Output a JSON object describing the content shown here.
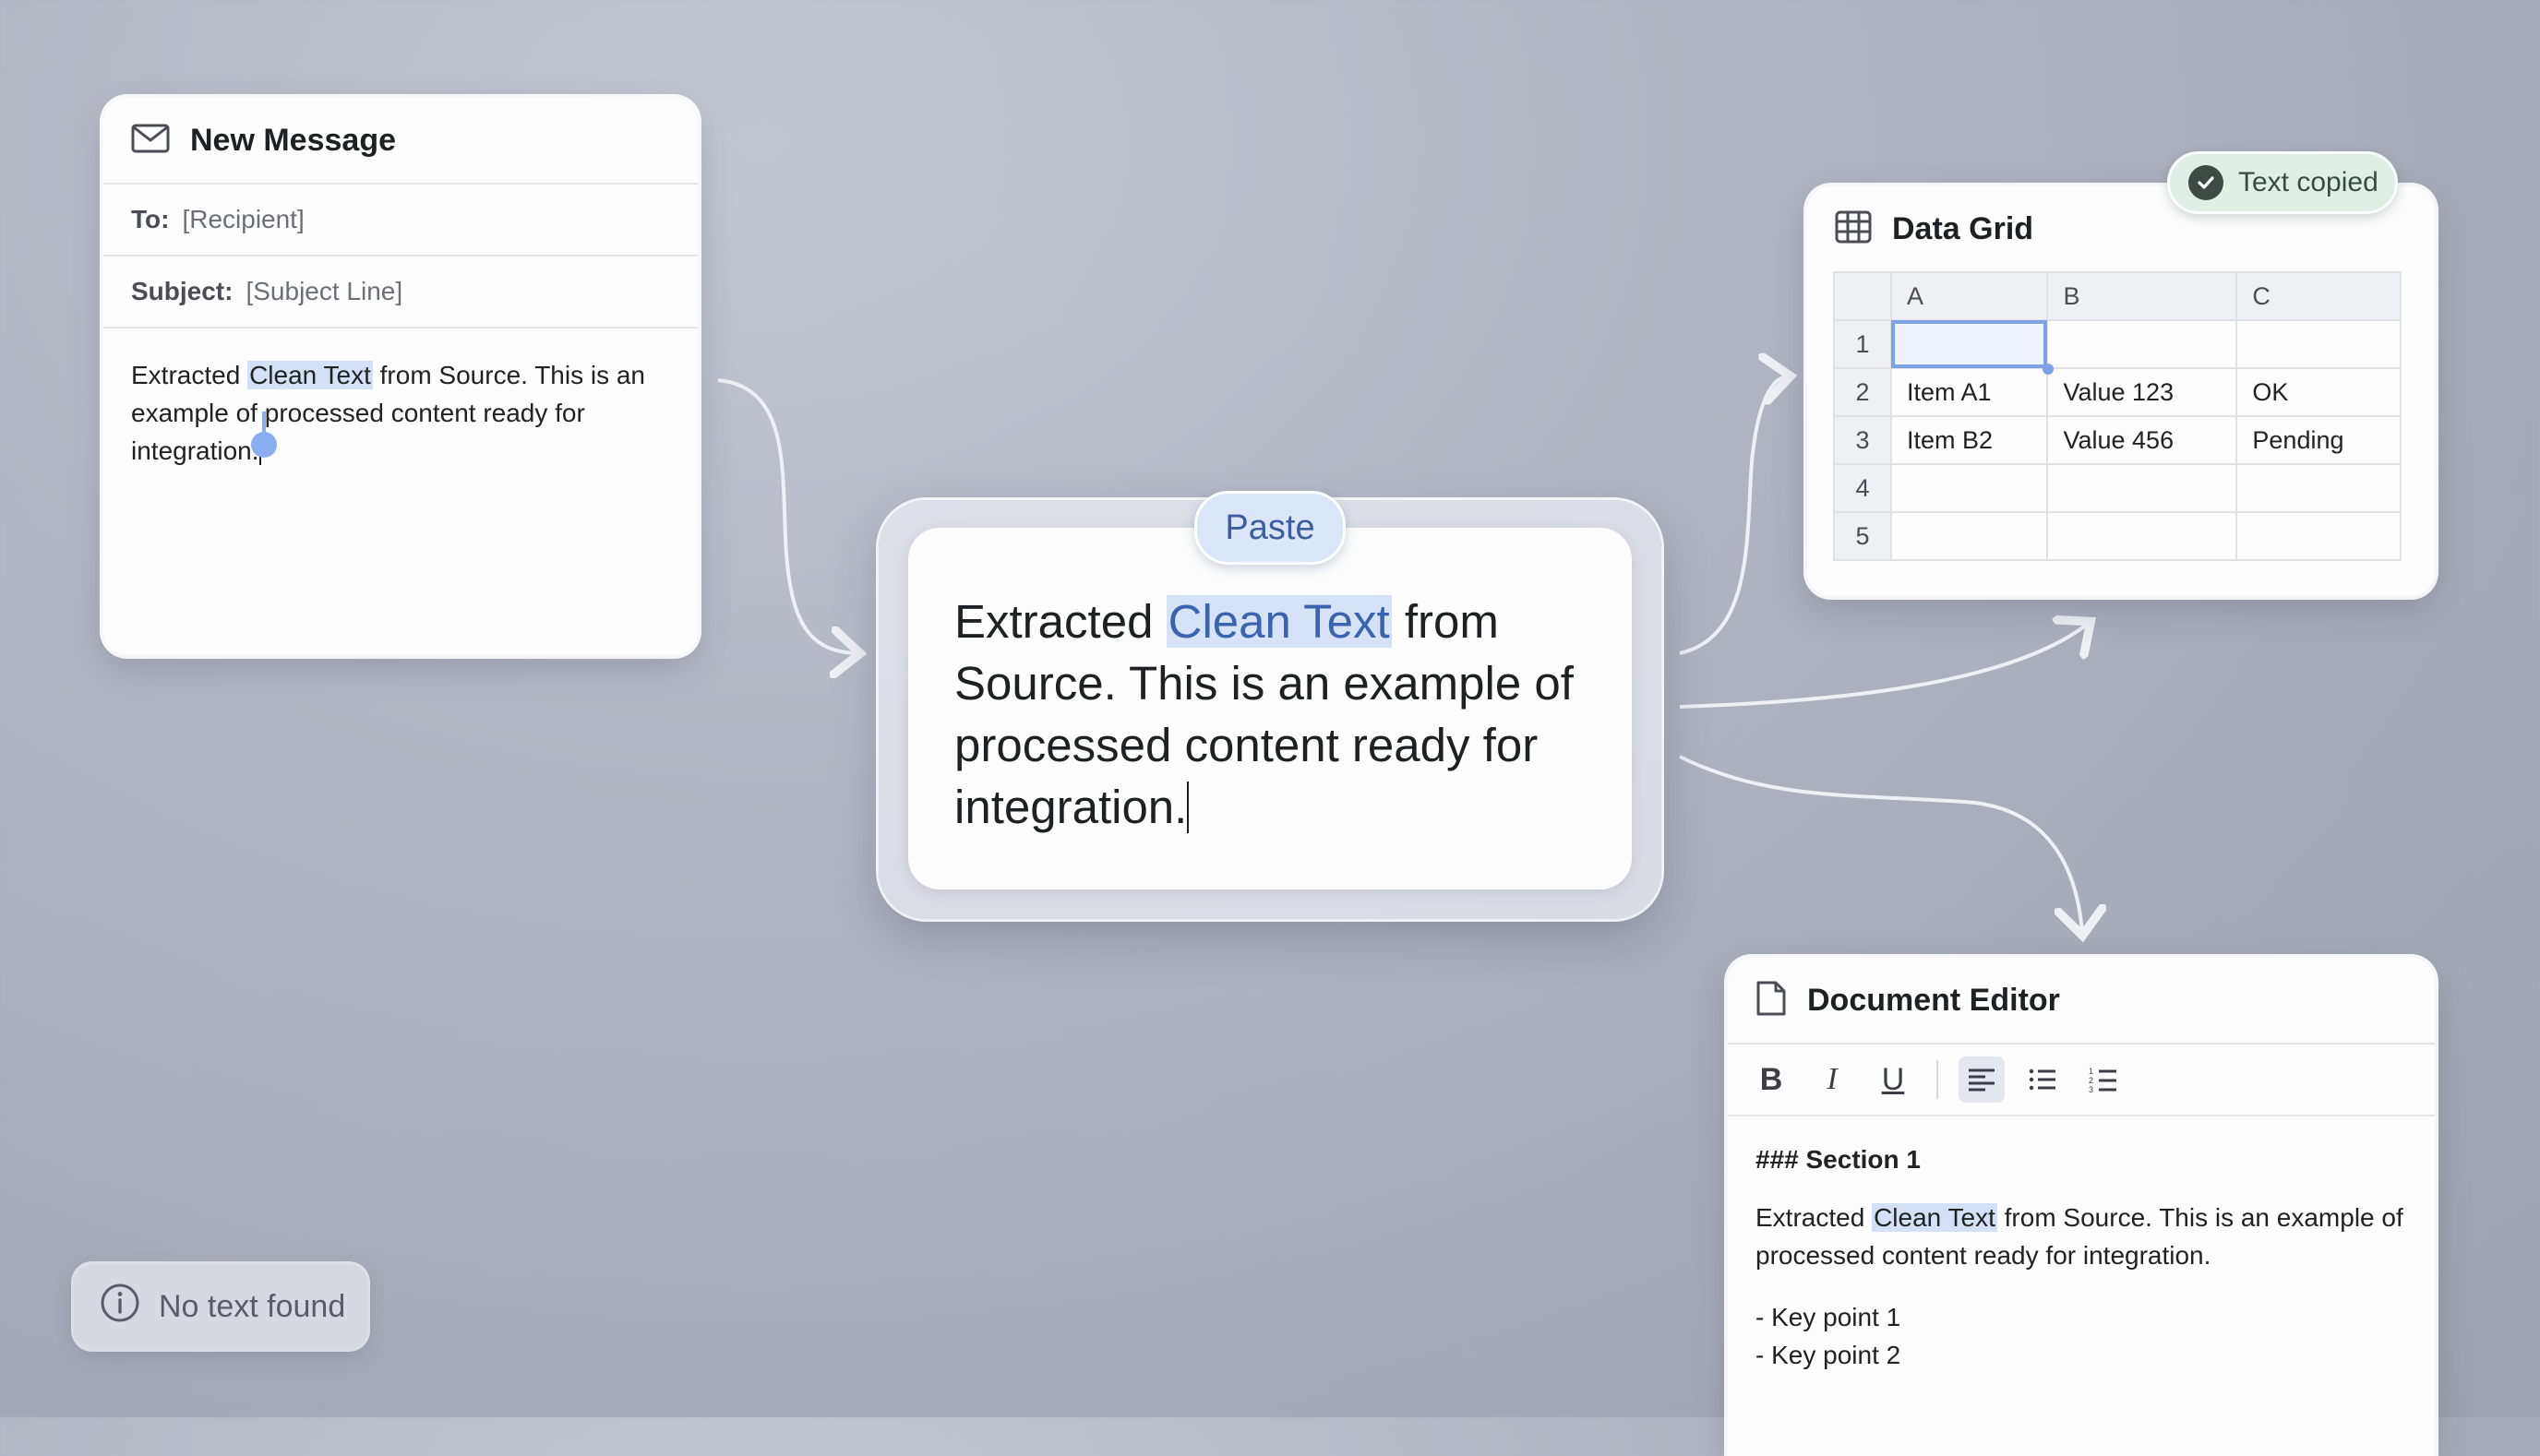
{
  "email": {
    "title": "New Message",
    "to_label": "To:",
    "to_value": "[Recipient]",
    "subject_label": "Subject:",
    "subject_value": "[Subject Line]",
    "body_before": "Extracted ",
    "body_highlight": "Clean Text",
    "body_after": " from Source. This is an example of processed content ready for integration."
  },
  "paste": {
    "pill_label": "Paste",
    "text_before": "Extracted ",
    "text_highlight": "Clean Text",
    "text_after": " from Source. This is an example of processed content ready for integration."
  },
  "grid": {
    "title": "Data Grid",
    "toast": "Text copied",
    "columns": [
      "A",
      "B",
      "C"
    ],
    "rows": [
      {
        "num": "1",
        "cells": [
          "",
          "",
          ""
        ]
      },
      {
        "num": "2",
        "cells": [
          "Item A1",
          "Value 123",
          "OK"
        ]
      },
      {
        "num": "3",
        "cells": [
          "Item B2",
          "Value 456",
          "Pending"
        ]
      },
      {
        "num": "4",
        "cells": [
          "",
          "",
          ""
        ]
      },
      {
        "num": "5",
        "cells": [
          "",
          "",
          ""
        ]
      }
    ]
  },
  "doc": {
    "title": "Document Editor",
    "toolbar": {
      "bold": "B",
      "italic": "I",
      "underline": "U"
    },
    "heading": "### Section 1",
    "para_before": "Extracted ",
    "para_highlight": "Clean Text",
    "para_after": " from Source. This is an example of processed content ready for integration.",
    "bullet1": "- Key point 1",
    "bullet2": "- Key point 2"
  },
  "status": {
    "no_text": "No text found"
  },
  "colors": {
    "highlight": "#d3e0f7",
    "accent": "#7ea2e6",
    "success": "#3f4a44"
  }
}
